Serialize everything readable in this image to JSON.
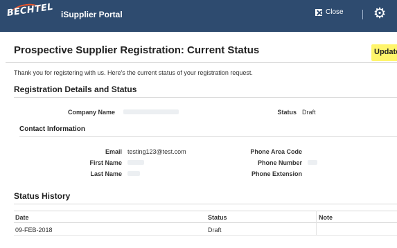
{
  "header": {
    "logo_text": "BECHTEL",
    "portal_title": "iSupplier Portal",
    "close_label": "Close",
    "icons": {
      "close": "close-box-icon",
      "settings": "gear-icon"
    },
    "bar_color": "#2e4b6f",
    "logo_accent": "#e8542a"
  },
  "page": {
    "title": "Prospective Supplier Registration: Current Status",
    "update_label": "Update",
    "update_color": "#fff56b",
    "intro": "Thank you for registering with us. Here's the current status of your registration request."
  },
  "details": {
    "section_title": "Registration Details and Status",
    "company_name_label": "Company Name",
    "status_label": "Status",
    "status_value": "Draft"
  },
  "contact": {
    "section_title": "Contact Information",
    "email_label": "Email",
    "email_value": "testing123@test.com",
    "first_name_label": "First Name",
    "last_name_label": "Last Name",
    "phone_area_label": "Phone Area Code",
    "phone_number_label": "Phone Number",
    "phone_ext_label": "Phone Extension"
  },
  "history": {
    "section_title": "Status History",
    "columns": [
      "Date",
      "Status",
      "Note"
    ],
    "rows": [
      {
        "date": "09-FEB-2018",
        "status": "Draft",
        "note": ""
      }
    ]
  }
}
